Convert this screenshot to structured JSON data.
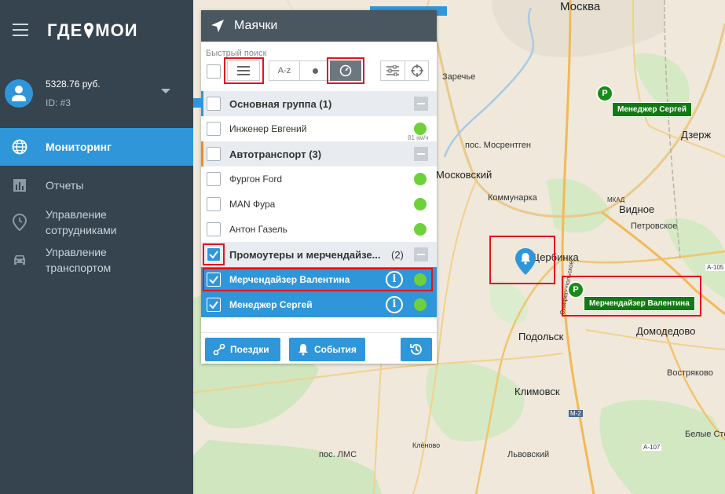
{
  "sidebar": {
    "logo": "ГДЕ МОИ",
    "account": {
      "balance": "5328.76 руб.",
      "id": "ID: #3"
    },
    "nav": [
      {
        "label": "Мониторинг",
        "icon": "globe-icon",
        "active": true
      },
      {
        "label": "Отчеты",
        "icon": "bar-chart-icon"
      },
      {
        "label": "Управление сотрудниками",
        "icon": "location-clock-icon"
      },
      {
        "label": "Управление транспортом",
        "icon": "car-icon"
      }
    ]
  },
  "panel": {
    "title": "Маячки",
    "quick_search_label": "Быстрый поиск",
    "sort_az": "A-z",
    "groups": [
      {
        "name": "Основная группа",
        "count": "(1)",
        "accent": "#2f97d9",
        "items": [
          {
            "name": "Инженер Евгений",
            "speed": "81 км/ч",
            "status": "#6fd13a"
          }
        ]
      },
      {
        "name": "Автотранспорт",
        "count": "(3)",
        "accent": "#f08a24",
        "items": [
          {
            "name": "Фургон Ford",
            "status": "#6fd13a"
          },
          {
            "name": "MAN Фура",
            "status": "#6fd13a"
          },
          {
            "name": "Антон Газель",
            "status": "#6fd13a"
          }
        ]
      },
      {
        "name": "Промоутеры и мерчендайзе...",
        "count": "(2)",
        "accent": "#2f97d9",
        "items": [
          {
            "name": "Мерчендайзер Валентина",
            "status": "#6fd13a",
            "selected": true
          },
          {
            "name": "Менеджер Сергей",
            "status": "#6fd13a",
            "selected": true
          }
        ]
      }
    ],
    "footer": {
      "trips": "Поездки",
      "events": "События"
    }
  },
  "map": {
    "cities": {
      "moscow": "Москва",
      "zarechye": "Заречье",
      "mosrentgen": "пос. Мосрентген",
      "moskovsky": "Московский",
      "kommunarka": "Коммунарка",
      "vidnoye": "Видное",
      "petrovskoe": "Петровское",
      "dzerzh": "Дзерж",
      "shcherbinka": "Щербинка",
      "podolsk": "Подольск",
      "domodedovo": "Домодедово",
      "klimovsk": "Климовск",
      "vostryakovo": "Востряково",
      "lms": "пос. ЛМС",
      "klenovo": "Клёново",
      "lvovsky": "Львовский",
      "belye": "Белые Сто",
      "mkad": "МКАД",
      "a105": "А-105",
      "a107": "А-107",
      "m2": "М-2",
      "simf": "Симферопольское"
    },
    "markers": [
      {
        "letter": "P",
        "label": "Менеджер Сергей"
      },
      {
        "letter": "P",
        "label": "Мерчендайзер Валентина"
      }
    ]
  }
}
